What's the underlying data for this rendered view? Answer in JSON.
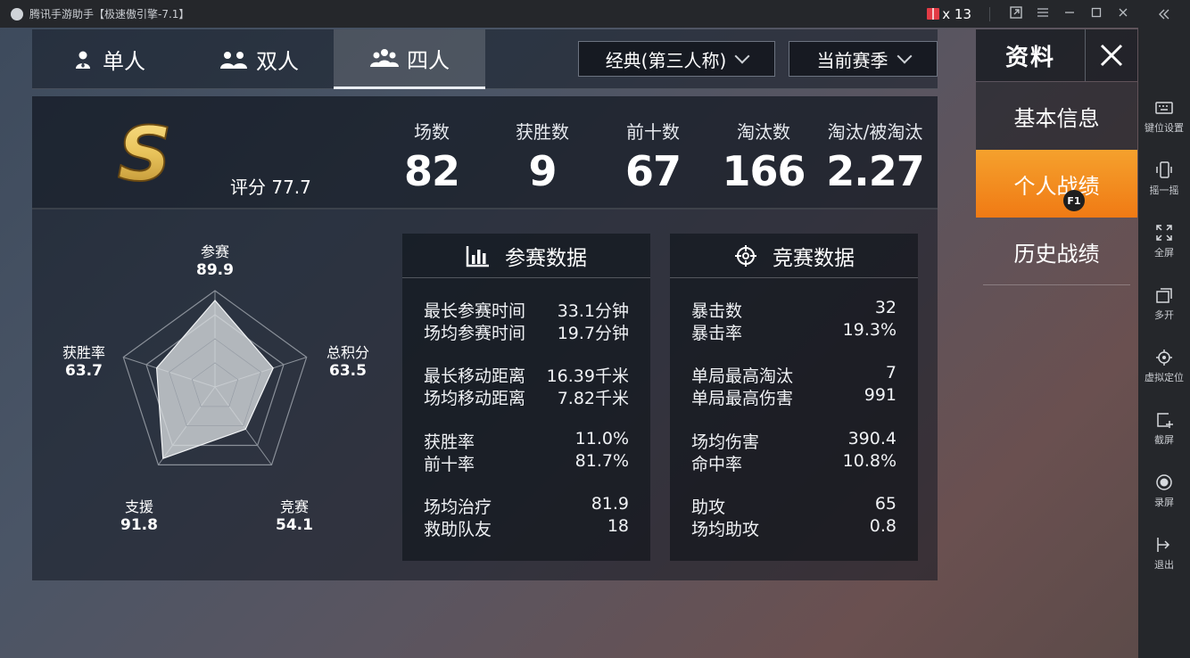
{
  "window": {
    "title": "腾讯手游助手【极速傲引擎-7.1】",
    "gift_count": "x 13"
  },
  "emulator_sidebar": {
    "items": [
      {
        "label": "键位设置",
        "icon": "keyboard-icon"
      },
      {
        "label": "摇一摇",
        "icon": "shake-phone-icon"
      },
      {
        "label": "全屏",
        "icon": "fullscreen-icon"
      },
      {
        "label": "多开",
        "icon": "multi-instance-icon"
      },
      {
        "label": "虚拟定位",
        "icon": "location-icon"
      },
      {
        "label": "截屏",
        "icon": "screenshot-icon"
      },
      {
        "label": "录屏",
        "icon": "record-icon"
      },
      {
        "label": "退出",
        "icon": "exit-icon"
      }
    ]
  },
  "mode_tabs": [
    {
      "label": "单人",
      "icon": "solo-icon",
      "active": false
    },
    {
      "label": "双人",
      "icon": "duo-icon",
      "active": false
    },
    {
      "label": "四人",
      "icon": "squad-icon",
      "active": true
    }
  ],
  "filters": {
    "mode": "经典(第三人称)",
    "season": "当前赛季"
  },
  "right_panel": {
    "title": "资料",
    "items": [
      {
        "label": "基本信息",
        "active": false
      },
      {
        "label": "个人战绩",
        "active": true,
        "hotkey": "F1"
      },
      {
        "label": "历史战绩",
        "active": false
      }
    ]
  },
  "summary": {
    "rank_letter": "S",
    "score_label": "评分 77.7",
    "stats": [
      {
        "label": "场数",
        "value": "82"
      },
      {
        "label": "获胜数",
        "value": "9"
      },
      {
        "label": "前十数",
        "value": "67"
      },
      {
        "label": "淘汰数",
        "value": "166"
      },
      {
        "label": "淘汰/被淘汰",
        "value": "2.27"
      }
    ]
  },
  "radar": {
    "axes": [
      {
        "name": "参赛",
        "value": "89.9",
        "score": 89.9
      },
      {
        "name": "总积分",
        "value": "63.5",
        "score": 63.5
      },
      {
        "name": "竞赛",
        "value": "54.1",
        "score": 54.1
      },
      {
        "name": "支援",
        "value": "91.8",
        "score": 91.8
      },
      {
        "name": "获胜率",
        "value": "63.7",
        "score": 63.7
      }
    ],
    "max": 100,
    "colors": {
      "fill": "#d9dcdf",
      "grid": "#8a9099"
    }
  },
  "participation": {
    "title": "参赛数据",
    "icon": "bar-chart-icon",
    "rows": [
      {
        "label": "最长参赛时间",
        "value": "33.1分钟"
      },
      {
        "label": "场均参赛时间",
        "value": "19.7分钟"
      },
      {
        "label": "最长移动距离",
        "value": "16.39千米"
      },
      {
        "label": "场均移动距离",
        "value": "7.82千米"
      },
      {
        "label": "获胜率",
        "value": "11.0%"
      },
      {
        "label": "前十率",
        "value": "81.7%"
      },
      {
        "label": "场均治疗",
        "value": "81.9"
      },
      {
        "label": "救助队友",
        "value": "18"
      }
    ]
  },
  "combat": {
    "title": "竞赛数据",
    "icon": "crosshair-icon",
    "rows": [
      {
        "label": "暴击数",
        "value": "32"
      },
      {
        "label": "暴击率",
        "value": "19.3%"
      },
      {
        "label": "单局最高淘汰",
        "value": "7"
      },
      {
        "label": "单局最高伤害",
        "value": "991"
      },
      {
        "label": "场均伤害",
        "value": "390.4"
      },
      {
        "label": "命中率",
        "value": "10.8%"
      },
      {
        "label": "助攻",
        "value": "65"
      },
      {
        "label": "场均助攻",
        "value": "0.8"
      }
    ]
  },
  "theme": {
    "accent": "#f5a12d",
    "accent_dark": "#f07a14",
    "gold": "#e8c25a"
  }
}
